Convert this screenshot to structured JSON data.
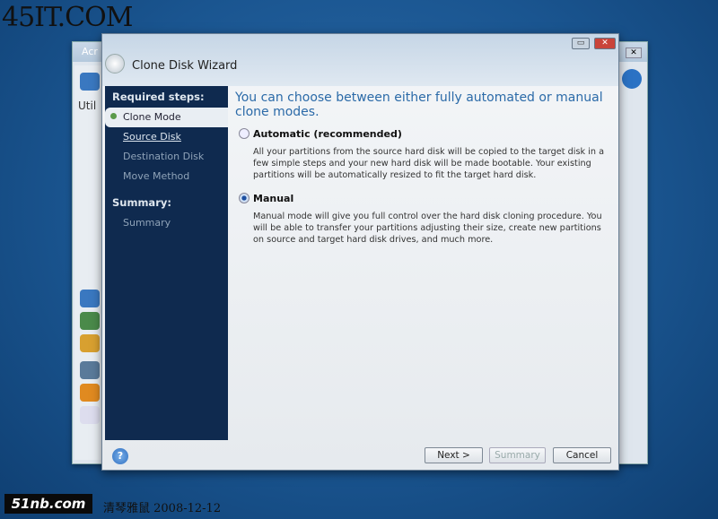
{
  "watermark_top": "45IT.COM",
  "background_window": {
    "title": "Acr",
    "section": "Util",
    "close": "✕"
  },
  "wizard": {
    "title": "Clone Disk Wizard",
    "controls": {
      "restore": "▭",
      "close": "✕"
    },
    "sidebar": {
      "required_heading": "Required steps:",
      "steps": [
        {
          "label": "Clone Mode",
          "state": "current"
        },
        {
          "label": "Source Disk",
          "state": "link"
        },
        {
          "label": "Destination Disk",
          "state": "disabled"
        },
        {
          "label": "Move Method",
          "state": "disabled"
        }
      ],
      "summary_heading": "Summary:",
      "summary_items": [
        {
          "label": "Summary",
          "state": "disabled"
        }
      ]
    },
    "heading": "You can choose between either fully automated or manual clone modes.",
    "options": [
      {
        "label": "Automatic (recommended)",
        "selected": false,
        "description": "All your partitions from the source hard disk will be copied to the target disk in a few simple steps and your new hard disk will be made bootable. Your existing partitions will be automatically resized to fit the target hard disk."
      },
      {
        "label": "Manual",
        "selected": true,
        "description": "Manual mode will give you full control over the hard disk cloning procedure. You will be able to transfer your partitions adjusting their size, create new partitions on source and target hard disk drives, and much more."
      }
    ],
    "buttons": {
      "next": "Next >",
      "summary": "Summary",
      "cancel": "Cancel",
      "help": "?"
    }
  },
  "footer": {
    "logo": "51nb.com",
    "caption": "清琴雅鼠  2008-12-12"
  }
}
